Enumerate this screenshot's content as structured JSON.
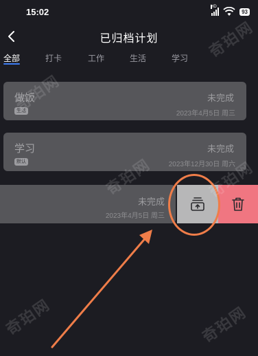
{
  "status_bar": {
    "time": "15:02",
    "network": "HD",
    "battery": "93"
  },
  "header": {
    "title": "已归档计划",
    "back_icon": "chevron-left-icon"
  },
  "tabs": [
    {
      "label": "全部",
      "active": true
    },
    {
      "label": "打卡",
      "active": false
    },
    {
      "label": "工作",
      "active": false
    },
    {
      "label": "生活",
      "active": false
    },
    {
      "label": "学习",
      "active": false
    }
  ],
  "plans": [
    {
      "title": "做饭",
      "tag": "生活",
      "status": "未完成",
      "date": "2023年4月5日 周三"
    },
    {
      "title": "学习",
      "tag": "默认",
      "status": "未完成",
      "date": "2023年12月30日 周六"
    }
  ],
  "swiped_plan": {
    "status": "未完成",
    "date": "2023年4月5日 周三",
    "actions": {
      "unarchive_icon": "unarchive-icon",
      "delete_icon": "trash-icon"
    }
  },
  "watermark": "奇珀网",
  "colors": {
    "background": "#1c1c22",
    "card": "#56565a",
    "tab_accent": "#3d7cf2",
    "unarchive_bg": "#b7b7b8",
    "delete_bg": "#f07681",
    "annotation": "#ef7d49"
  }
}
